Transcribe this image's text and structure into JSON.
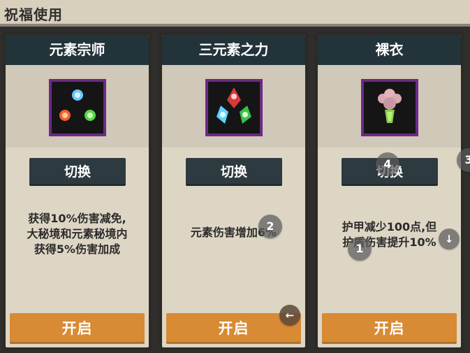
{
  "window": {
    "title": "祝福使用"
  },
  "cards": [
    {
      "title": "元素宗师",
      "switch_label": "切换",
      "description_lines": [
        "获得10%伤害减免,",
        "大秘境和元素秘境内",
        "获得5%伤害加成"
      ],
      "open_label": "开启"
    },
    {
      "title": "三元素之力",
      "switch_label": "切换",
      "description_lines": [
        "元素伤害增加6%"
      ],
      "open_label": "开启"
    },
    {
      "title": "裸衣",
      "switch_label": "切换",
      "description_lines": [
        "护甲减少100点,但",
        "护盾伤害提升10%"
      ],
      "open_label": "开启"
    }
  ],
  "overlays": {
    "markers": [
      {
        "label": "1"
      },
      {
        "label": "2"
      },
      {
        "label": "3"
      },
      {
        "label": "4"
      },
      {
        "label": "↓"
      },
      {
        "label": "←"
      }
    ]
  },
  "icons": {
    "card1": "elemental-master-icon",
    "card2": "three-element-power-icon",
    "card3": "bare-shirt-icon"
  }
}
